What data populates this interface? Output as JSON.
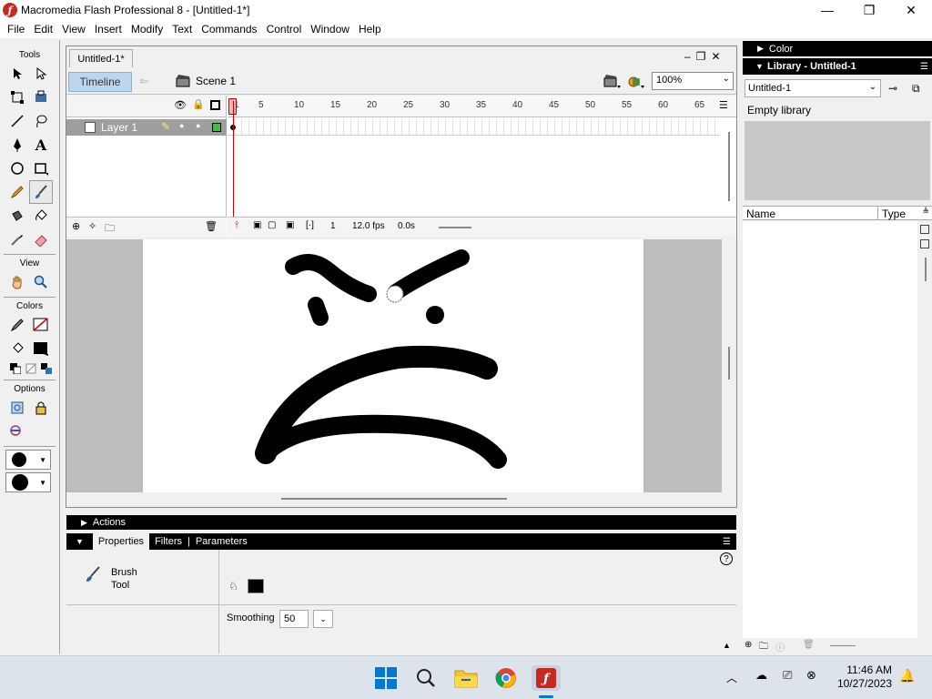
{
  "window": {
    "title": "Macromedia Flash Professional 8 - [Untitled-1*]",
    "minimize_glyph": "—",
    "maximize_glyph": "❐",
    "close_glyph": "✕"
  },
  "menu": [
    "File",
    "Edit",
    "View",
    "Insert",
    "Modify",
    "Text",
    "Commands",
    "Control",
    "Window",
    "Help"
  ],
  "tools": {
    "title": "Tools",
    "view_title": "View",
    "colors_title": "Colors",
    "options_title": "Options"
  },
  "document": {
    "tab": "Untitled-1*",
    "timeline_button": "Timeline",
    "scene": "Scene 1",
    "zoom": "100%"
  },
  "timeline": {
    "layer_name": "Layer 1",
    "ruler": [
      "1",
      "5",
      "10",
      "15",
      "20",
      "25",
      "30",
      "35",
      "40",
      "45",
      "50",
      "55",
      "60",
      "65"
    ],
    "current_frame": "1",
    "fps": "12.0 fps",
    "elapsed": "0.0s"
  },
  "panels": {
    "actions": "Actions",
    "tabs": [
      "Properties",
      "Filters",
      "Parameters"
    ],
    "tool_name_line1": "Brush",
    "tool_name_line2": "Tool",
    "smoothing_label": "Smoothing",
    "smoothing_value": "50",
    "help_glyph": "?"
  },
  "right": {
    "color_title": "Color",
    "library_title": "Library - Untitled-1",
    "library_select": "Untitled-1",
    "empty_text": "Empty library",
    "col_name": "Name",
    "col_type": "Type"
  },
  "taskbar": {
    "time": "11:46 AM",
    "date": "10/27/2023"
  }
}
